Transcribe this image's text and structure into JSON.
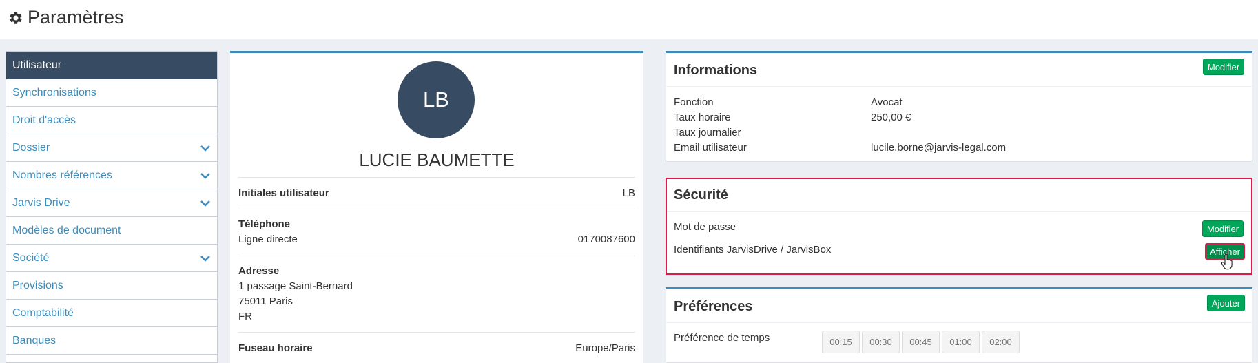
{
  "header": {
    "title": "Paramètres"
  },
  "sidebar": {
    "items": [
      {
        "label": "Utilisateur",
        "active": true,
        "has_chevron": false
      },
      {
        "label": "Synchronisations",
        "has_chevron": false
      },
      {
        "label": "Droit d'accès",
        "has_chevron": false
      },
      {
        "label": "Dossier",
        "has_chevron": true
      },
      {
        "label": "Nombres références",
        "has_chevron": true
      },
      {
        "label": "Jarvis Drive",
        "has_chevron": true
      },
      {
        "label": "Modèles de document",
        "has_chevron": false
      },
      {
        "label": "Société",
        "has_chevron": true
      },
      {
        "label": "Provisions",
        "has_chevron": false
      },
      {
        "label": "Comptabilité",
        "has_chevron": false
      },
      {
        "label": "Banques",
        "has_chevron": false
      }
    ]
  },
  "profile": {
    "avatar_initials": "LB",
    "name": "LUCIE BAUMETTE",
    "initials_label": "Initiales utilisateur",
    "initials_value": "LB",
    "phone_label": "Téléphone",
    "direct_line_label": "Ligne directe",
    "direct_line_value": "0170087600",
    "address_label": "Adresse",
    "address_line1": "1 passage Saint-Bernard",
    "address_line2": "75011 Paris",
    "address_line3": "FR",
    "timezone_label": "Fuseau horaire",
    "timezone_value": "Europe/Paris"
  },
  "informations": {
    "title": "Informations",
    "edit_label": "Modifier",
    "rows": [
      {
        "label": "Fonction",
        "value": "Avocat"
      },
      {
        "label": "Taux horaire",
        "value": "250,00 €"
      },
      {
        "label": "Taux journalier",
        "value": ""
      },
      {
        "label": "Email utilisateur",
        "value": "lucile.borne@jarvis-legal.com"
      }
    ]
  },
  "security": {
    "title": "Sécurité",
    "password_label": "Mot de passe",
    "password_button": "Modifier",
    "credentials_label": "Identifiants JarvisDrive / JarvisBox",
    "credentials_button": "Afficher"
  },
  "preferences": {
    "title": "Préférences",
    "add_label": "Ajouter",
    "time_pref_label": "Préférence de temps",
    "time_options": [
      "00:15",
      "00:30",
      "00:45",
      "01:00",
      "02:00"
    ]
  },
  "colors": {
    "accent": "#3c8dbc",
    "sidebar_active": "#374c62",
    "button_green": "#00a65a",
    "highlight_red": "#dd1c4b"
  }
}
